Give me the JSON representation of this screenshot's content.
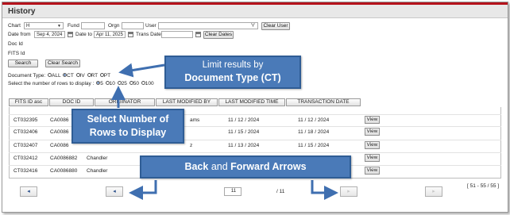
{
  "window": {
    "title": "History"
  },
  "filters": {
    "chart": {
      "label": "Chart",
      "value": "H"
    },
    "fund": {
      "label": "Fund",
      "value": ""
    },
    "orgn": {
      "label": "Orgn",
      "value": ""
    },
    "user": {
      "label": "User",
      "value": ""
    },
    "clear_user_label": "Clear User",
    "date_from": {
      "label": "Date from",
      "value": "Sep 4, 2024"
    },
    "date_to": {
      "label": "Date to",
      "value": "Apr 11, 2025"
    },
    "trans_date": {
      "label": "Trans Date",
      "value": ""
    },
    "clear_dates_label": "Clear Dates",
    "doc_id": {
      "label": "Doc Id",
      "value": ""
    },
    "fits_id": {
      "label": "FITS Id",
      "value": ""
    },
    "search_label": "Search",
    "clear_search_label": "Clear Search",
    "doc_type": {
      "label": "Document Type:",
      "options": [
        "ALL",
        "CT",
        "IV",
        "RT",
        "PT"
      ],
      "selected": "CT"
    },
    "rows": {
      "label": "Select the number of rows to display :",
      "options": [
        "5",
        "10",
        "25",
        "50",
        "100"
      ],
      "selected": "5"
    }
  },
  "table": {
    "headers": [
      "FITS ID asc",
      "DOC ID",
      "ORIGINATOR",
      "LAST MODIFIED BY",
      "LAST MODIFIED TIME",
      "TRANSACTION DATE"
    ],
    "view_label": "View",
    "rows": [
      {
        "fits_id": "CT032395",
        "doc_id": "CA0086",
        "originator": "",
        "modified_by": "ams",
        "modified_time": "11 / 12 / 2024",
        "trans_date": "11 / 12 / 2024"
      },
      {
        "fits_id": "CT032406",
        "doc_id": "CA0086",
        "originator": "",
        "modified_by": "",
        "modified_time": "11 / 15 / 2024",
        "trans_date": "11 / 18 / 2024"
      },
      {
        "fits_id": "CT032407",
        "doc_id": "CA0086",
        "originator": "",
        "modified_by": "z",
        "modified_time": "11 / 13 / 2024",
        "trans_date": "11 / 15 / 2024"
      },
      {
        "fits_id": "CT032412",
        "doc_id": "CA0086882",
        "originator": "Chandler",
        "modified_by": "",
        "modified_time": "",
        "trans_date": ""
      },
      {
        "fits_id": "CT032416",
        "doc_id": "CA0086880",
        "originator": "Chandler",
        "modified_by": "",
        "modified_time": "",
        "trans_date": ""
      }
    ]
  },
  "pager": {
    "first_icon": "first-page-icon",
    "prev_icon": "prev-page-icon",
    "next_icon": "next-page-icon",
    "last_icon": "last-page-icon",
    "page_value": "11",
    "total_pages": "/ 11",
    "range_text": "[ 51 - 55 / 55 ]"
  },
  "callouts": {
    "doc_type": {
      "line1": "Limit results by",
      "line2": "Document Type (CT)"
    },
    "rows": {
      "line1": "Select Number of",
      "line2": "Rows to Display"
    },
    "arrows": {
      "part1": "Back",
      "part2": " and ",
      "part3": "Forward Arrows"
    }
  },
  "colors": {
    "accent_red": "#b5121b",
    "callout_blue": "#4a7ab8",
    "arrow_blue": "#3f6fb0"
  }
}
